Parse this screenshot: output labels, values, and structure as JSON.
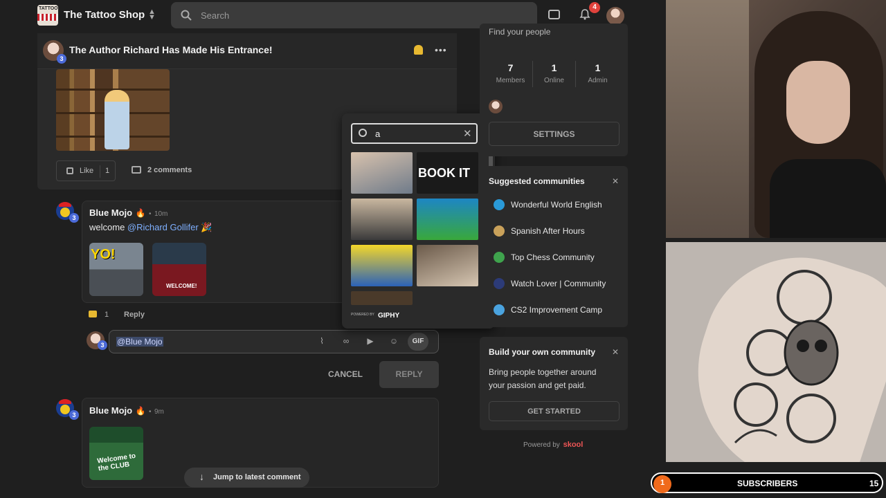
{
  "header": {
    "logo_text": "TATTOO",
    "shop_name": "The Tattoo Shop",
    "search_placeholder": "Search",
    "notification_count": "4"
  },
  "post": {
    "title": "The Author Richard Has Made His Entrance!",
    "author_level": "3",
    "like_label": "Like",
    "like_count": "1",
    "comments_label": "2 comments"
  },
  "comments": [
    {
      "name": "Blue Mojo",
      "fire": "🔥",
      "time": "10m",
      "text_prefix": "welcome ",
      "mention": "@Richard Gollifer",
      "text_suffix": " 🎉",
      "level": "3",
      "gifs": [
        "YO!",
        "WELCOME!"
      ],
      "likes": "1",
      "reply_label": "Reply"
    },
    {
      "name": "Blue Mojo",
      "fire": "🔥",
      "time": "9m",
      "level": "3",
      "gifs": [
        "Welcome to the CLUB"
      ]
    }
  ],
  "reply_box": {
    "value": "@Blue Mojo",
    "gif_label": "GIF",
    "cancel_label": "CANCEL",
    "reply_label": "REPLY"
  },
  "gif_picker": {
    "search_value": "a",
    "tiles": [
      "",
      "BOOK IT",
      "",
      "",
      "",
      "",
      "",
      ""
    ],
    "powered_by": "POWERED BY",
    "provider": "GIPHY"
  },
  "jump_label": "Jump to latest comment",
  "sidebar": {
    "find_people": "Find your people",
    "stats": [
      {
        "value": "7",
        "label": "Members"
      },
      {
        "value": "1",
        "label": "Online"
      },
      {
        "value": "1",
        "label": "Admin"
      }
    ],
    "settings_label": "SETTINGS",
    "suggested_title": "Suggested communities",
    "communities": [
      {
        "name": "Wonderful World English",
        "color": "#2a9ad8"
      },
      {
        "name": "Spanish After Hours",
        "color": "#c9a15a"
      },
      {
        "name": "Top Chess Community",
        "color": "#3fa34d"
      },
      {
        "name": "Watch Lover | Community",
        "color": "#2c3b78"
      },
      {
        "name": "CS2 Improvement Camp",
        "color": "#4aa3df"
      }
    ],
    "build_title": "Build your own community",
    "build_text": "Bring people together around your passion and get paid.",
    "get_started_label": "GET STARTED",
    "powered_by": "Powered by",
    "brand": "skool"
  },
  "overlay": {
    "subscribers_label": "SUBSCRIBERS",
    "subscribers_count": "15",
    "dot_value": "1"
  }
}
